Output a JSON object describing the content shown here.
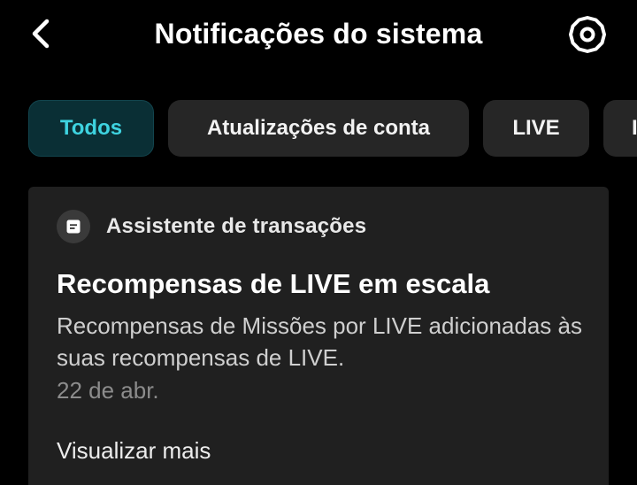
{
  "header": {
    "title": "Notificações do sistema",
    "back_icon": "chevron-left-icon",
    "settings_icon": "gear-icon"
  },
  "tabs": [
    {
      "label": "Todos",
      "active": true
    },
    {
      "label": "Atualizações de conta",
      "active": false
    },
    {
      "label": "LIVE",
      "active": false
    },
    {
      "label": "I",
      "active": false
    }
  ],
  "notification": {
    "source_icon": "receipt-icon",
    "source": "Assistente de transações",
    "title": "Recompensas de LIVE em escala",
    "body": "Recompensas de Missões por LIVE adicionadas às suas recompensas de LIVE.",
    "date": "22 de abr.",
    "more_label": "Visualizar mais"
  },
  "colors": {
    "background": "#000000",
    "card": "#202020",
    "tab": "#262626",
    "tab_active_bg": "#0a2f35",
    "tab_active_text": "#3ed3e0"
  }
}
